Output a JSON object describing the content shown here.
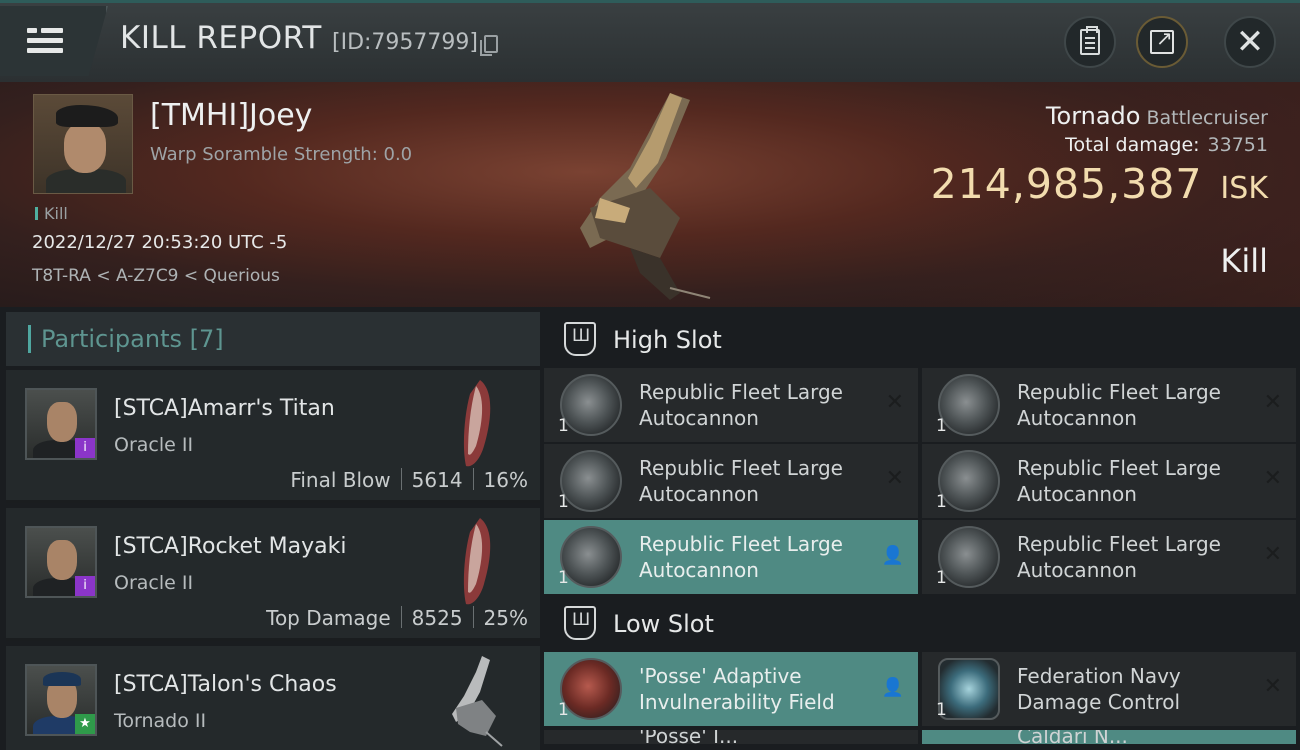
{
  "header": {
    "title": "KILL REPORT",
    "report_id": "[ID:7957799]"
  },
  "victim": {
    "name": "[TMHI]Joey",
    "scramble": "Warp Soramble Strength: 0.0",
    "tag": "Kill",
    "datetime": "2022/12/27 20:53:20 UTC -5",
    "location": "T8T-RA < A-Z7C9 < Querious",
    "ship": "Tornado",
    "ship_class": "Battlecruiser",
    "total_damage_label": "Total damage:",
    "total_damage": "33751",
    "isk_value": "214,985,387",
    "isk_unit": "ISK",
    "result": "Kill"
  },
  "participants": {
    "title": "Participants",
    "count": "[7]",
    "rows": [
      {
        "name": "[STCA]Amarr's Titan",
        "ship": "Oracle II",
        "role": "Final Blow",
        "damage": "5614",
        "pct": "16%",
        "badge": "i"
      },
      {
        "name": "[STCA]Rocket Mayaki",
        "ship": "Oracle II",
        "role": "Top Damage",
        "damage": "8525",
        "pct": "25%",
        "badge": "i"
      },
      {
        "name": "[STCA]Talon's Chaos",
        "ship": "Tornado II",
        "badge": "★"
      }
    ]
  },
  "fitting": {
    "high_slot_title": "High Slot",
    "low_slot_title": "Low Slot",
    "high_slot": [
      {
        "name": "Republic Fleet Large Autocannon",
        "qty": "1",
        "status": "✕"
      },
      {
        "name": "Republic Fleet Large Autocannon",
        "qty": "1",
        "status": "✕"
      },
      {
        "name": "Republic Fleet Large Autocannon",
        "qty": "1",
        "status": "✕"
      },
      {
        "name": "Republic Fleet Large Autocannon",
        "qty": "1",
        "status": "✕"
      },
      {
        "name": "Republic Fleet Large Autocannon",
        "qty": "1",
        "status": "👤"
      },
      {
        "name": "Republic Fleet Large Autocannon",
        "qty": "1",
        "status": "✕"
      }
    ],
    "low_slot": [
      {
        "name": "'Posse' Adaptive Invulnerability Field",
        "qty": "1",
        "status": "👤"
      },
      {
        "name": "Federation Navy Damage Control",
        "qty": "1",
        "status": "✕"
      }
    ],
    "low_slot_peek": [
      "'Posse' I...",
      "Caldari N..."
    ]
  },
  "colors": {
    "accent": "#4f8a83",
    "isk": "#f2dcae",
    "badge_purple": "#8b35c9",
    "badge_green": "#2f9a4a"
  }
}
